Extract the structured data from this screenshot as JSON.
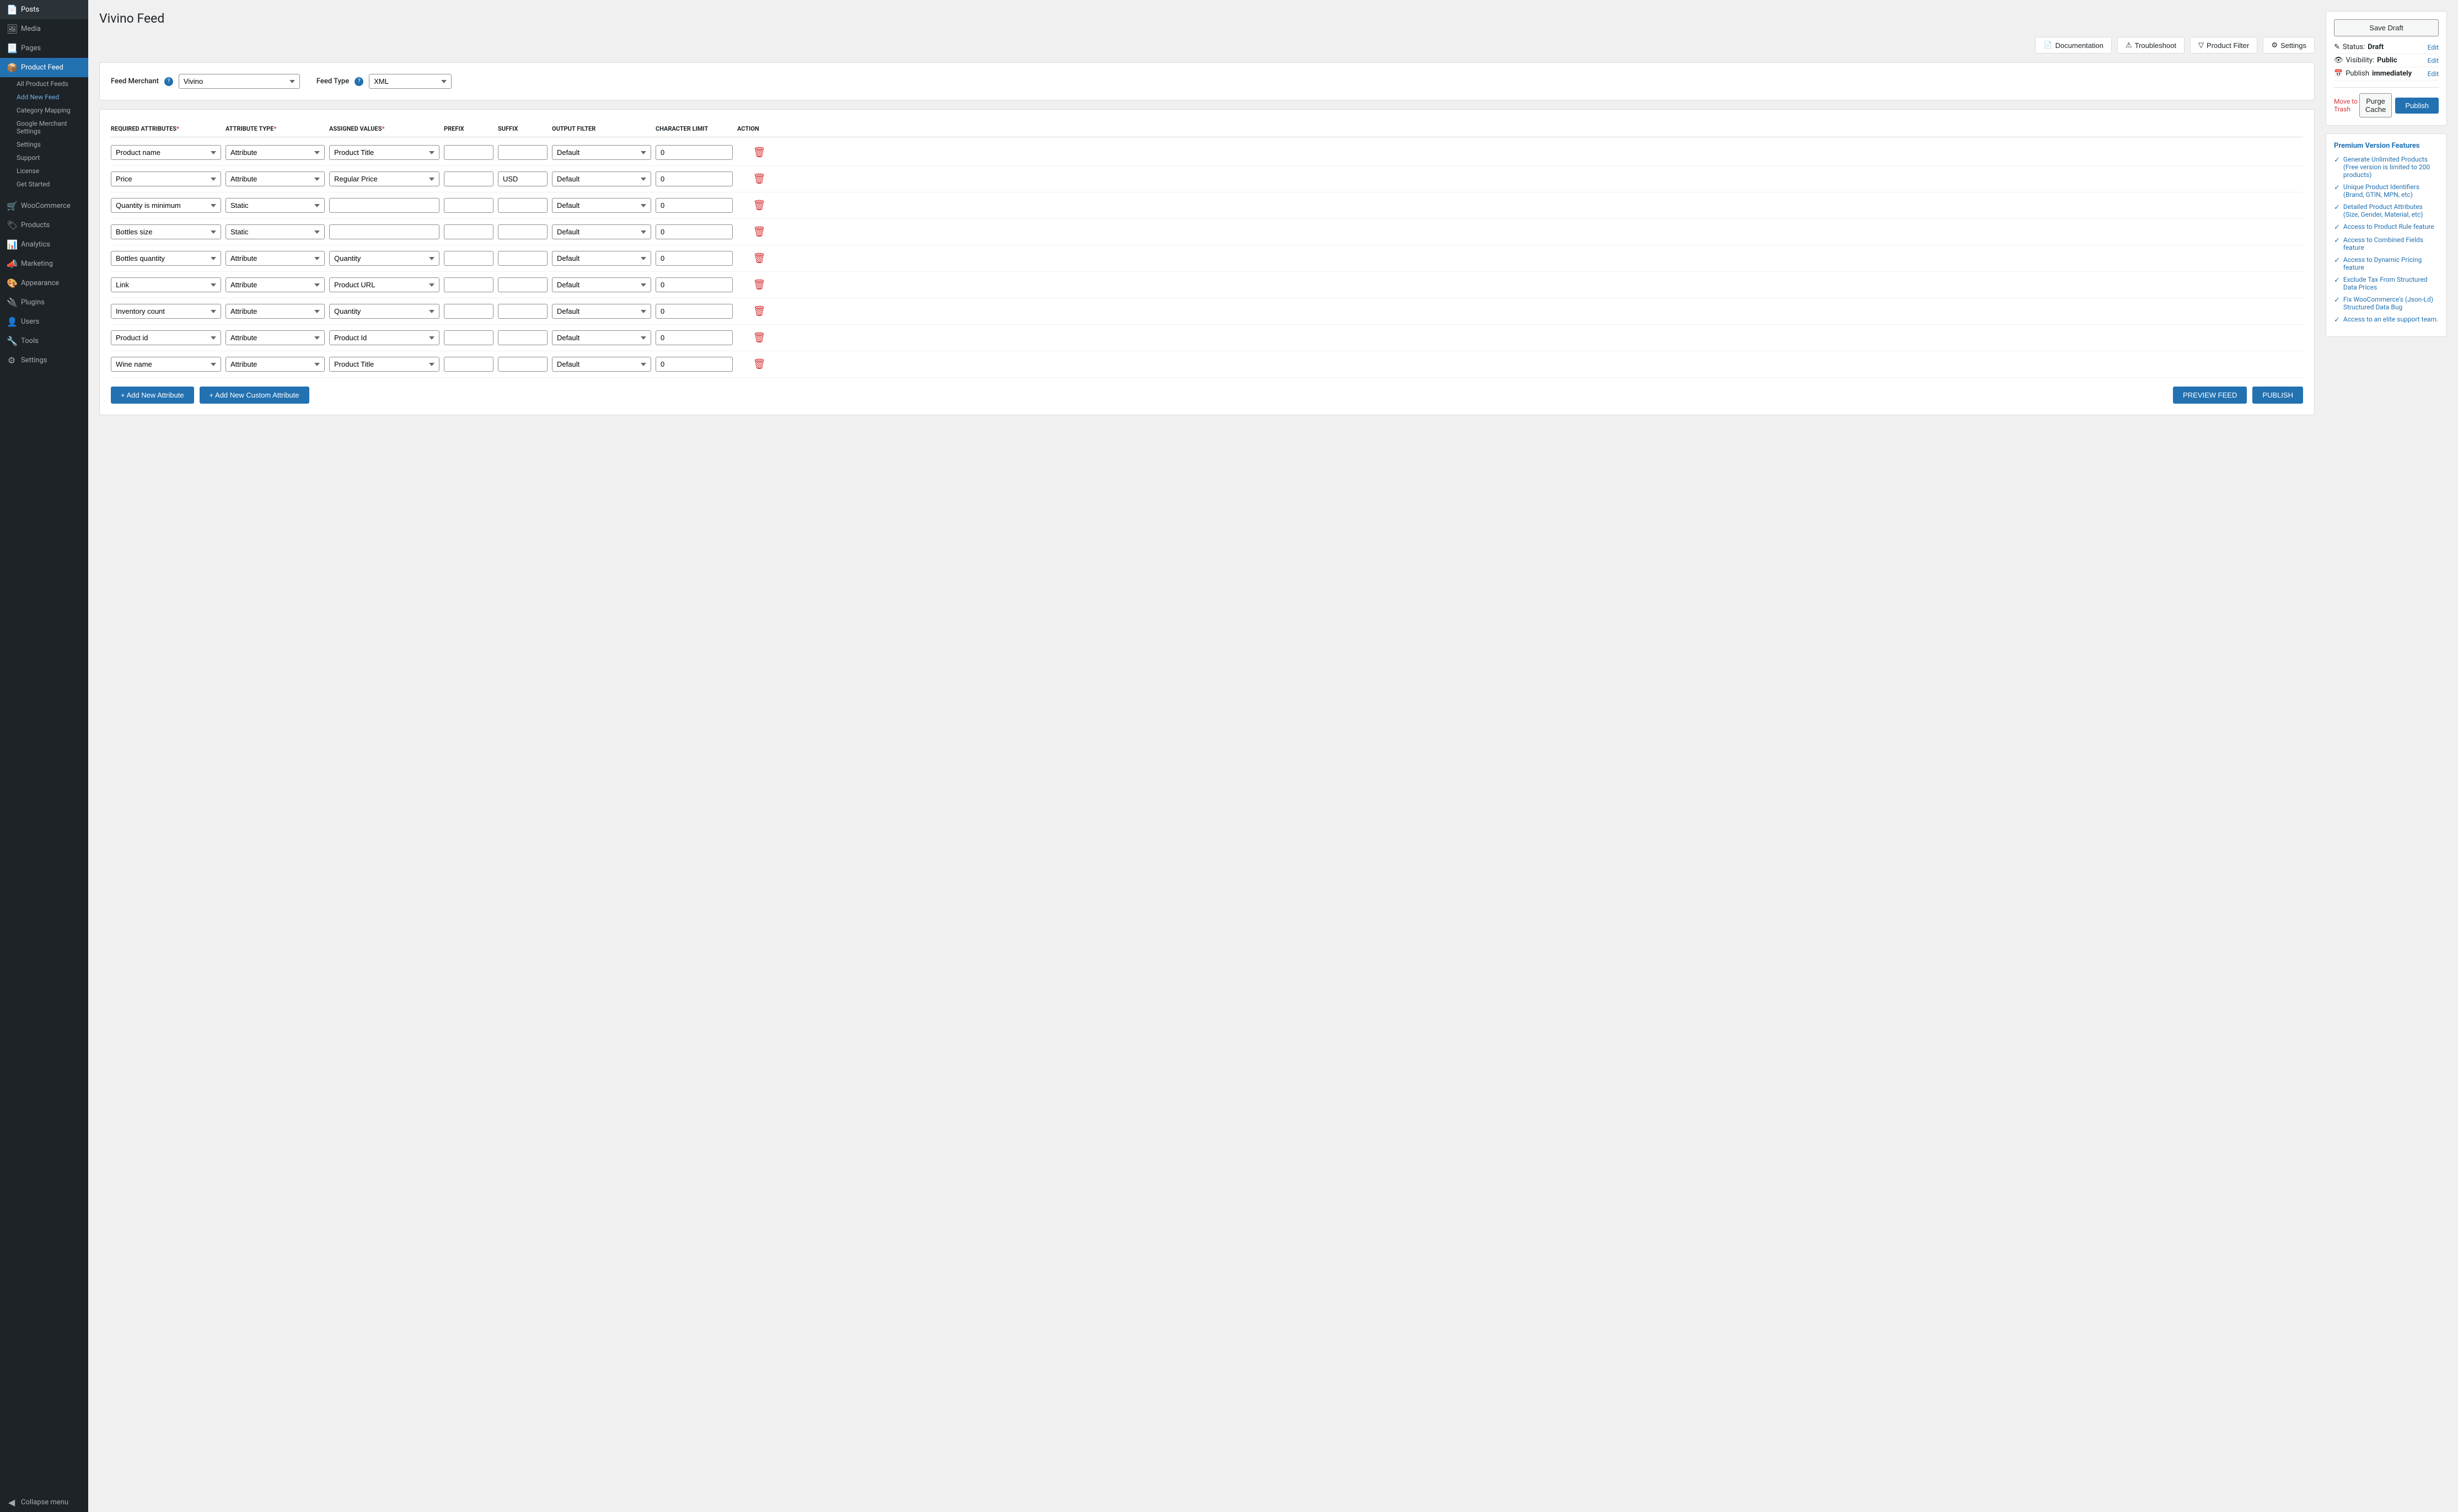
{
  "sidebar": {
    "items": [
      {
        "id": "posts",
        "label": "Posts",
        "icon": "📄"
      },
      {
        "id": "media",
        "label": "Media",
        "icon": "🖼"
      },
      {
        "id": "pages",
        "label": "Pages",
        "icon": "📃"
      },
      {
        "id": "product-feed",
        "label": "Product Feed",
        "icon": "📦",
        "active": true
      },
      {
        "id": "woocommerce",
        "label": "WooCommerce",
        "icon": "🛒"
      },
      {
        "id": "products",
        "label": "Products",
        "icon": "🏷"
      },
      {
        "id": "analytics",
        "label": "Analytics",
        "icon": "📊"
      },
      {
        "id": "marketing",
        "label": "Marketing",
        "icon": "📣"
      },
      {
        "id": "appearance",
        "label": "Appearance",
        "icon": "🎨"
      },
      {
        "id": "plugins",
        "label": "Plugins",
        "icon": "🔌"
      },
      {
        "id": "users",
        "label": "Users",
        "icon": "👤"
      },
      {
        "id": "tools",
        "label": "Tools",
        "icon": "🔧"
      },
      {
        "id": "settings",
        "label": "Settings",
        "icon": "⚙"
      }
    ],
    "subitems": [
      {
        "id": "all-feeds",
        "label": "All Product Feeds"
      },
      {
        "id": "add-new",
        "label": "Add New Feed",
        "active": true
      },
      {
        "id": "category",
        "label": "Category Mapping"
      },
      {
        "id": "google-merchant",
        "label": "Google Merchant Settings"
      },
      {
        "id": "settings-sub",
        "label": "Settings"
      },
      {
        "id": "support",
        "label": "Support"
      },
      {
        "id": "license",
        "label": "License"
      },
      {
        "id": "get-started",
        "label": "Get Started"
      }
    ],
    "collapse_label": "Collapse menu"
  },
  "page": {
    "title": "Vivino Feed"
  },
  "action_bar": {
    "documentation": "Documentation",
    "troubleshoot": "Troubleshoot",
    "product_filter": "Product Filter",
    "settings": "Settings"
  },
  "feed_config": {
    "merchant_label": "Feed Merchant",
    "merchant_value": "Vivino",
    "feed_type_label": "Feed Type",
    "feed_type_value": "XML"
  },
  "table": {
    "headers": {
      "required": "REQUIRED ATTRIBUTES*",
      "type": "ATTRIBUTE TYPE*",
      "assigned": "ASSIGNED VALUES*",
      "prefix": "PREFIX",
      "suffix": "SUFFIX",
      "output_filter": "OUTPUT FILTER",
      "char_limit": "CHARACTER LIMIT",
      "action": "ACTION"
    },
    "rows": [
      {
        "id": "row-1",
        "required": "Product name",
        "type": "Attribute",
        "assigned": "Product Title",
        "prefix": "",
        "suffix": "",
        "output_filter": "Default",
        "char_limit": "0"
      },
      {
        "id": "row-2",
        "required": "Price",
        "type": "Attribute",
        "assigned": "Regular Price",
        "prefix": "",
        "suffix": "USD",
        "output_filter": "Default",
        "char_limit": "0"
      },
      {
        "id": "row-3",
        "required": "Quantity is minimum",
        "type": "Static",
        "assigned": "",
        "prefix": "",
        "suffix": "",
        "output_filter": "Default",
        "char_limit": "0"
      },
      {
        "id": "row-4",
        "required": "Bottles size",
        "type": "Static",
        "assigned": "",
        "prefix": "",
        "suffix": "",
        "output_filter": "Default",
        "char_limit": "0"
      },
      {
        "id": "row-5",
        "required": "Bottles quantity",
        "type": "Attribute",
        "assigned": "Quantity",
        "prefix": "",
        "suffix": "",
        "output_filter": "Default",
        "char_limit": "0"
      },
      {
        "id": "row-6",
        "required": "Link",
        "type": "Attribute",
        "assigned": "Product URL",
        "prefix": "",
        "suffix": "",
        "output_filter": "Default",
        "char_limit": "0"
      },
      {
        "id": "row-7",
        "required": "Inventory count",
        "type": "Attribute",
        "assigned": "Quantity",
        "prefix": "",
        "suffix": "",
        "output_filter": "Default",
        "char_limit": "0"
      },
      {
        "id": "row-8",
        "required": "Product id",
        "type": "Attribute",
        "assigned": "Product Id",
        "prefix": "",
        "suffix": "",
        "output_filter": "Default",
        "char_limit": "0"
      },
      {
        "id": "row-9",
        "required": "Wine name",
        "type": "Attribute",
        "assigned": "Product Title",
        "prefix": "",
        "suffix": "",
        "output_filter": "Default",
        "char_limit": "0"
      }
    ]
  },
  "buttons": {
    "add_attribute": "+ Add New Attribute",
    "add_custom": "+ Add New Custom Attribute",
    "preview": "PREVIEW FEED",
    "publish": "PUBLISH"
  },
  "sidebar_right": {
    "save_draft": "Save Draft",
    "status_label": "Status:",
    "status_value": "Draft",
    "status_edit": "Edit",
    "visibility_label": "Visibility:",
    "visibility_value": "Public",
    "visibility_edit": "Edit",
    "publish_label": "Publish",
    "publish_value": "immediately",
    "publish_edit": "Edit",
    "trash_label": "Move to Trash",
    "purge_cache": "Purge Cache",
    "publish_btn": "Publish"
  },
  "premium": {
    "title": "Premium Version Features",
    "items": [
      {
        "text": "Generate Unlimited Products (Free version is limited to 200 products)"
      },
      {
        "text": "Unique Product Identifiers (Brand, GTIN, MPN, etc)"
      },
      {
        "text": "Detailed Product Attributes (Size, Gender, Material, etc)"
      },
      {
        "text": "Access to Product Rule feature"
      },
      {
        "text": "Access to Combined Fields feature"
      },
      {
        "text": "Access to Dynamic Pricing feature"
      },
      {
        "text": "Exclude Tax From Structured Data Prices"
      },
      {
        "text": "Fix WooCommerce's (Json-Ld) Structured Data Bug"
      },
      {
        "text": "Access to an elite support team."
      }
    ]
  }
}
